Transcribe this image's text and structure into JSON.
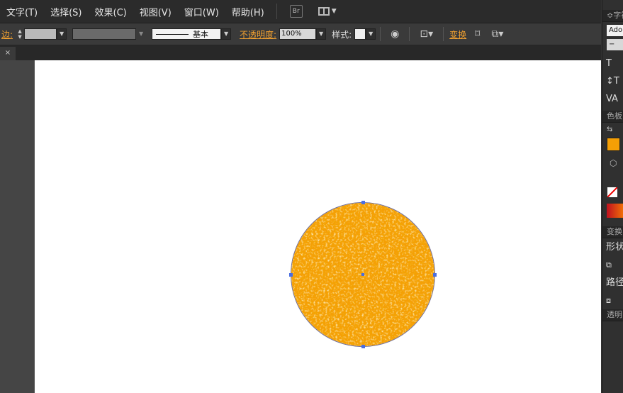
{
  "menubar": {
    "items": [
      {
        "label": "文字(T)"
      },
      {
        "label": "选择(S)"
      },
      {
        "label": "效果(C)"
      },
      {
        "label": "视图(V)"
      },
      {
        "label": "窗口(W)"
      },
      {
        "label": "帮助(H)"
      }
    ],
    "bridge_label": "Br",
    "workspace_caret": "▼"
  },
  "controlbar": {
    "stroke_label": "边:",
    "stroke_style_label": "基本",
    "opacity_label": "不透明度:",
    "opacity_value": "100%",
    "style_label": "样式:",
    "transform_label": "变换",
    "fill_color": "#b9b9b9",
    "stroke_color": "#6a6a6a"
  },
  "document_tab": {
    "close_label": "×"
  },
  "artwork": {
    "circle_fill_base": "#f59f05",
    "circle_fill_light": "#fcd476",
    "circle_fill_dark": "#e07800",
    "anchor_color": "#4a6ee0"
  },
  "panels": {
    "character_header": "字符",
    "font_value": "Adobe",
    "font_size_value": "−",
    "text_icons": [
      "T",
      "↕T",
      "VA"
    ],
    "color_header": "色板",
    "fill_color": "#f59f05",
    "transform_header": "变换",
    "shape_label": "形状",
    "path_label": "路径",
    "transparency_header": "透明"
  }
}
